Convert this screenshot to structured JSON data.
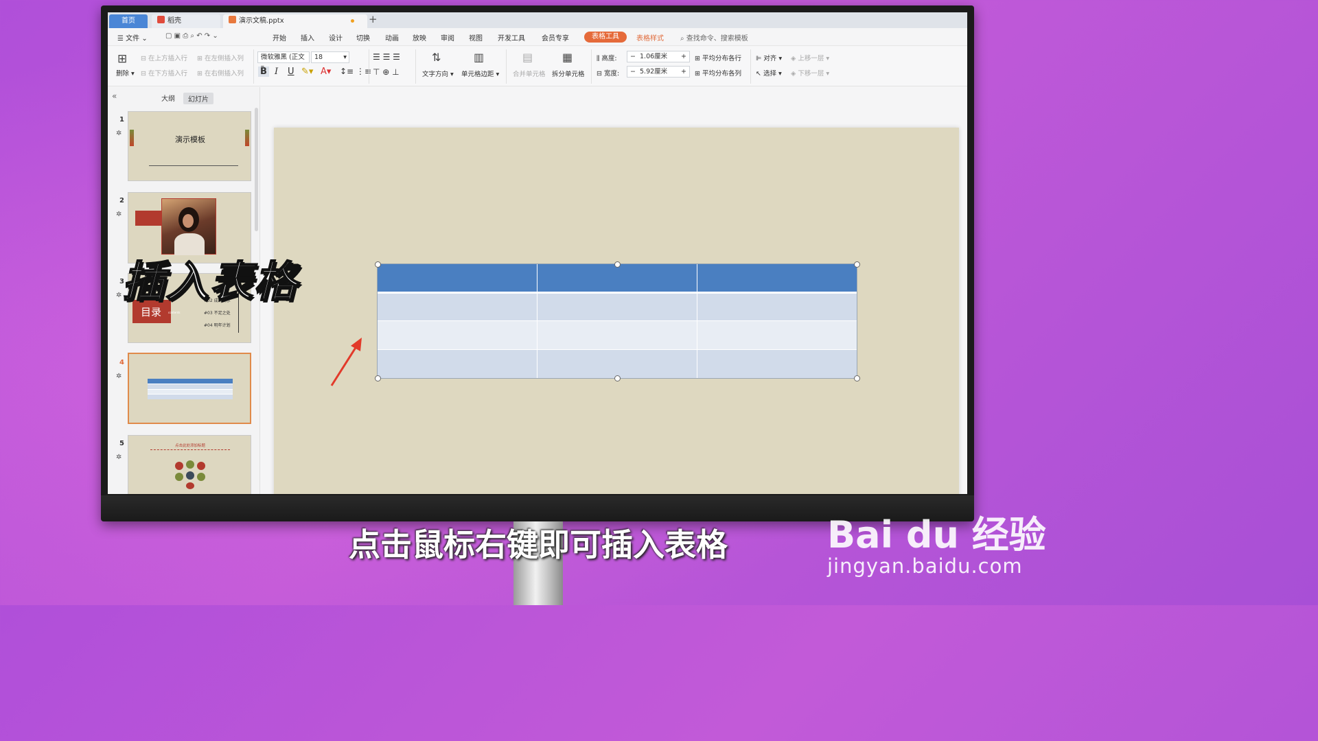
{
  "tabs": {
    "home": "首页",
    "straw": "稻壳",
    "doc": "演示文稿.pptx"
  },
  "menu": {
    "file": "文件",
    "items": [
      "开始",
      "插入",
      "设计",
      "切换",
      "动画",
      "放映",
      "审阅",
      "视图",
      "开发工具",
      "会员专享"
    ],
    "table_tools": "表格工具",
    "table_style": "表格样式",
    "search": "查找命令、搜索模板"
  },
  "ribbon": {
    "delete": "删除",
    "insert_above": "在上方插入行",
    "insert_below": "在下方插入行",
    "insert_left": "在左侧插入列",
    "insert_right": "在右侧插入列",
    "font_name": "微软雅黑 (正文",
    "font_size": "18",
    "text_dir": "文字方向",
    "cell_margin": "单元格边距",
    "merge": "合并单元格",
    "split": "拆分单元格",
    "height_label": "高度:",
    "height_value": "1.06厘米",
    "width_label": "宽度:",
    "width_value": "5.92厘米",
    "dist_rows": "平均分布各行",
    "dist_cols": "平均分布各列",
    "align": "对齐",
    "select": "选择",
    "bring_forward": "上移一层",
    "send_backward": "下移一层"
  },
  "panel": {
    "outline": "大纲",
    "slides": "幻灯片",
    "slide_numbers": [
      "1",
      "2",
      "3",
      "4",
      "5"
    ],
    "slide1_title": "演示模板",
    "slide3_title": "目录",
    "slide3_sub": "contents",
    "slide3_items": [
      "#02 成果展示",
      "#03 不足之处",
      "#04 明年计划"
    ],
    "slide5_title": "点击此处添加标题"
  },
  "overlay": {
    "big_title": "插入表格",
    "subtitle": "点击鼠标右键即可插入表格",
    "wm_logo": "Bai du 经验",
    "wm_url": "jingyan.baidu.com"
  },
  "colors": {
    "accent": "#e56a3a",
    "table_header": "#4a7fc1",
    "table_row_a": "#d1dbea",
    "table_row_b": "#e8edf4",
    "slide_bg": "#ded8c0"
  }
}
